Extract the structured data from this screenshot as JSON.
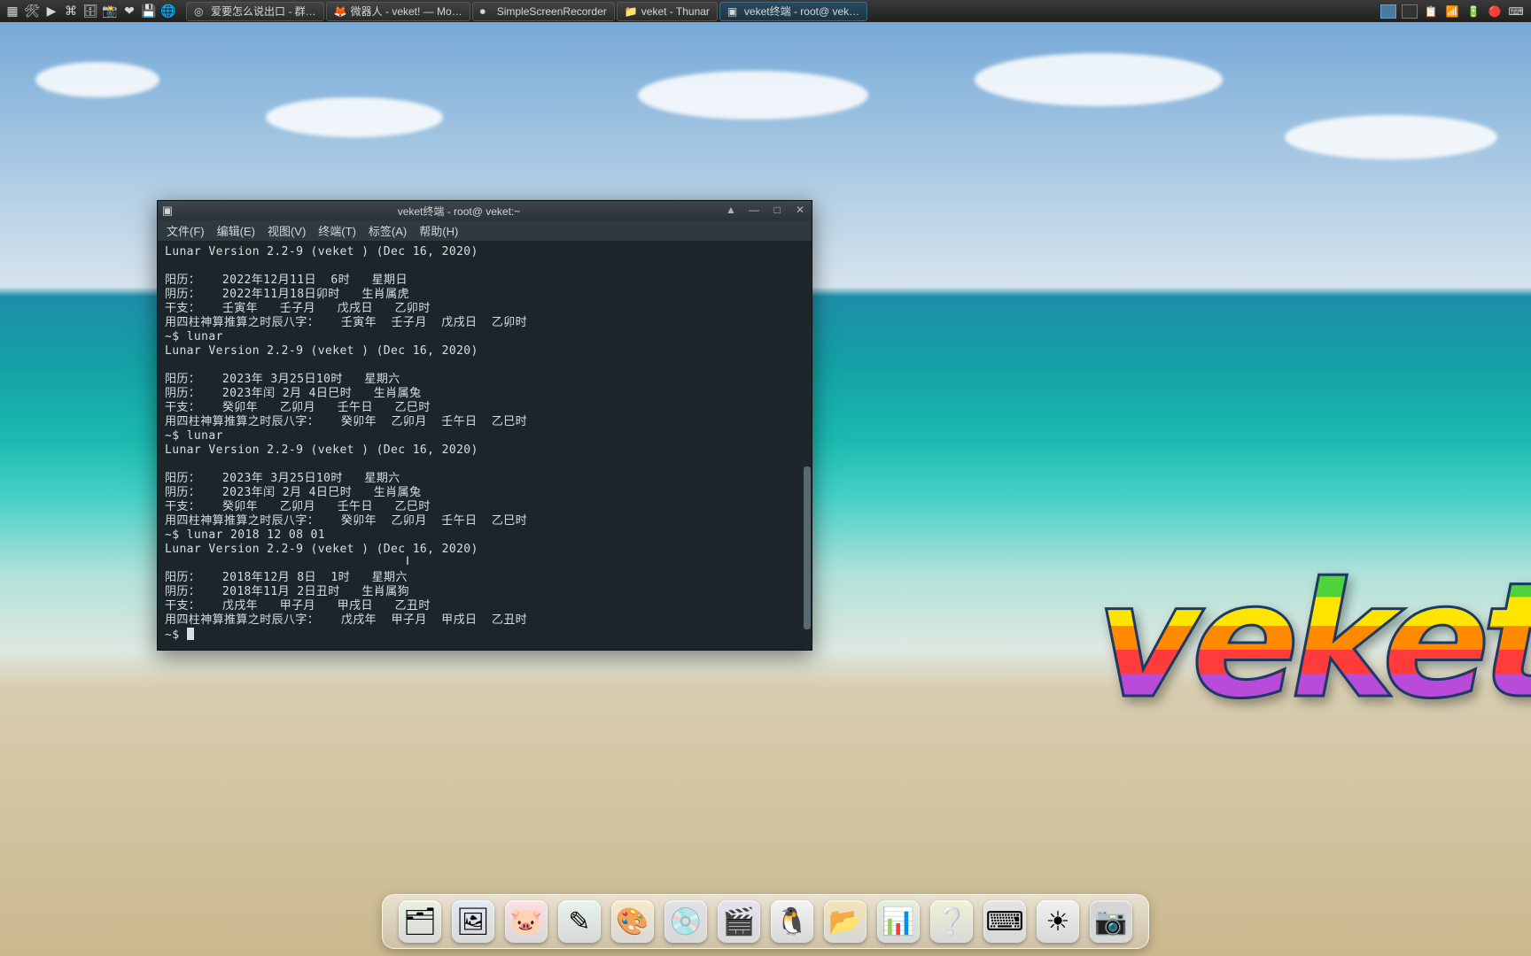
{
  "panel": {
    "launchers": [
      "menu",
      "tools",
      "play",
      "term",
      "files",
      "screenshot",
      "heart",
      "disk",
      "globe"
    ],
    "tasks": [
      {
        "icon": "chat",
        "label": "爱要怎么说出口 - 群…",
        "active": false
      },
      {
        "icon": "firefox",
        "label": "微器人 - veket! — Mo…",
        "active": false
      },
      {
        "icon": "rec",
        "label": "SimpleScreenRecorder",
        "active": false
      },
      {
        "icon": "folder",
        "label": "veket - Thunar",
        "active": false
      },
      {
        "icon": "term",
        "label": "veket终端 - root@ vek…",
        "active": true
      }
    ],
    "workspaces": 2,
    "tray": [
      "clipboard",
      "net",
      "battery",
      "rec-dot",
      "keyboard"
    ]
  },
  "terminal": {
    "title": "veket终端 - root@ veket:~",
    "menus": [
      "文件(F)",
      "编辑(E)",
      "视图(V)",
      "终端(T)",
      "标签(A)",
      "帮助(H)"
    ],
    "winbtns": [
      "▲",
      "—",
      "□",
      "✕"
    ],
    "lines": [
      "Lunar Version 2.2-9 (veket ) (Dec 16, 2020)",
      "",
      "阳历：   2022年12月11日  6时   星期日",
      "阴历：   2022年11月18日卯时   生肖属虎",
      "干支：   壬寅年   壬子月   戊戌日   乙卯时",
      "用四柱神算推算之时辰八字：   壬寅年  壬子月  戊戌日  乙卯时",
      "~$ lunar",
      "Lunar Version 2.2-9 (veket ) (Dec 16, 2020)",
      "",
      "阳历：   2023年 3月25日10时   星期六",
      "阴历：   2023年闰 2月 4日巳时   生肖属兔",
      "干支：   癸卯年   乙卯月   壬午日   乙巳时",
      "用四柱神算推算之时辰八字：   癸卯年  乙卯月  壬午日  乙巳时",
      "~$ lunar",
      "Lunar Version 2.2-9 (veket ) (Dec 16, 2020)",
      "",
      "阳历：   2023年 3月25日10时   星期六",
      "阴历：   2023年闰 2月 4日巳时   生肖属兔",
      "干支：   癸卯年   乙卯月   壬午日   乙巳时",
      "用四柱神算推算之时辰八字：   癸卯年  乙卯月  壬午日  乙巳时",
      "~$ lunar 2018 12 08 01",
      "Lunar Version 2.2-9 (veket ) (Dec 16, 2020)",
      "",
      "阳历：   2018年12月 8日  1时   星期六",
      "阴历：   2018年11月 2日丑时   生肖属狗",
      "干支：   戊戌年   甲子月   甲戌日   乙丑时",
      "用四柱神算推算之时辰八字：   戊戌年  甲子月  甲戌日  乙丑时"
    ],
    "prompt": "~$ "
  },
  "dock": {
    "items": [
      {
        "name": "file-manager",
        "glyph": "🗂",
        "bg": "#e8f2e0"
      },
      {
        "name": "image-editor",
        "glyph": "🖼",
        "bg": "#dfeaf5"
      },
      {
        "name": "pig-game",
        "glyph": "🐷",
        "bg": "#fbe0e4"
      },
      {
        "name": "text-editor",
        "glyph": "✎",
        "bg": "#e6f4ea"
      },
      {
        "name": "color-picker",
        "glyph": "🎨",
        "bg": "#f6eacb"
      },
      {
        "name": "disc-util",
        "glyph": "💿",
        "bg": "#dfe2e6"
      },
      {
        "name": "media-player",
        "glyph": "🎬",
        "bg": "#e7dff2"
      },
      {
        "name": "tux-app",
        "glyph": "🐧",
        "bg": "#f4f4f4"
      },
      {
        "name": "folder-open",
        "glyph": "📂",
        "bg": "#f6e3b6"
      },
      {
        "name": "office",
        "glyph": "📊",
        "bg": "#e0f0dc"
      },
      {
        "name": "help",
        "glyph": "❔",
        "bg": "#eef3d6"
      },
      {
        "name": "keyboard",
        "glyph": "⌨",
        "bg": "#e4e4e4"
      },
      {
        "name": "brightness",
        "glyph": "☀",
        "bg": "#f0f0f0"
      },
      {
        "name": "camera",
        "glyph": "📷",
        "bg": "#d4d4d4"
      }
    ]
  },
  "logo": "veket"
}
